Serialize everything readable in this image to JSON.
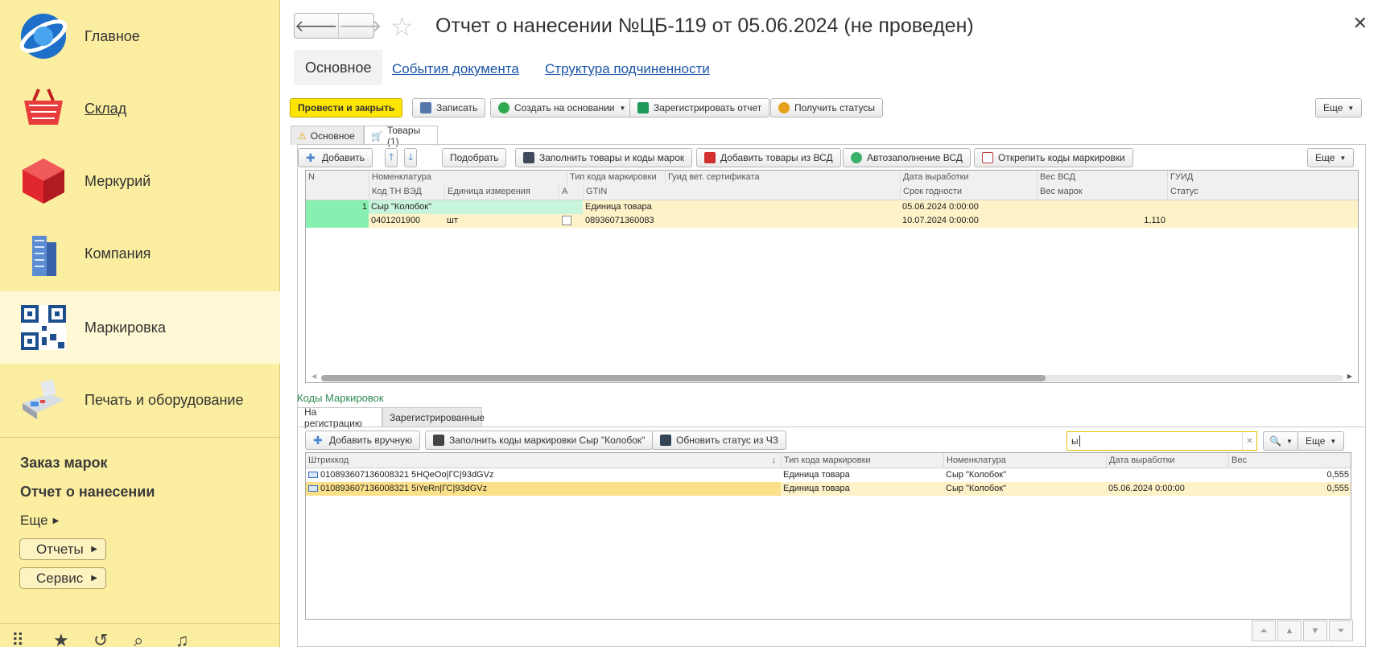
{
  "sidebar": {
    "items": [
      {
        "label": "Главное",
        "icon": "globe-icon"
      },
      {
        "label": "Склад",
        "icon": "basket-icon"
      },
      {
        "label": "Меркурий",
        "icon": "cube-icon"
      },
      {
        "label": "Компания",
        "icon": "building-icon"
      },
      {
        "label": "Маркировка",
        "icon": "qr-code-icon"
      },
      {
        "label": "Печать и оборудование",
        "icon": "card-terminal-icon"
      }
    ],
    "links": [
      "Заказ марок",
      "Отчет о нанесении"
    ],
    "more": "Еще",
    "reports_btn": "Отчеты",
    "service_btn": "Сервис"
  },
  "header": {
    "title": "Отчет о нанесении №ЦБ-119 от 05.06.2024 (не проведен)",
    "tabs": [
      "Основное",
      "События документа",
      "Структура подчиненности"
    ]
  },
  "toolbar": {
    "post_close": "Провести и закрыть",
    "save": "Записать",
    "create_based": "Создать на основании",
    "register_report": "Зарегистрировать отчет",
    "get_statuses": "Получить статусы",
    "more": "Еще"
  },
  "form_tabs": [
    "Основное",
    "Товары (1)"
  ],
  "goods_toolbar": {
    "add": "Добавить",
    "select": "Подобрать",
    "fill_goods": "Заполнить товары и коды марок",
    "add_from_vsd": "Добавить товары из ВСД",
    "autofill_vsd": "Автозаполнение ВСД",
    "detach_codes": "Открепить коды маркировки",
    "more": "Еще"
  },
  "goods_table": {
    "headers_row1": [
      "N",
      "Номенклатура",
      "Тип кода маркировки",
      "Гуид вет. сертификата",
      "Дата выработки",
      "Вес ВСД",
      "ГУИД"
    ],
    "headers_row2": [
      "Код ТН ВЭД",
      "Единица измерения",
      "А",
      "GTIN",
      "Срок годности",
      "Вес марок",
      "Статус"
    ],
    "row": {
      "n": "1",
      "nomenclature": "Сыр \"Колобок\"",
      "code_type": "Единица товара",
      "production_date": "05.06.2024 0:00:00",
      "tnved": "0401201900",
      "unit": "шт",
      "gtin": "08936071360083",
      "expiry": "10.07.2024 0:00:00",
      "marks_weight": "1,110"
    }
  },
  "codes_section": {
    "label": "Коды Маркировок",
    "tabs": [
      "На регистрацию",
      "Зарегистрированные"
    ],
    "add_manual": "Добавить вручную",
    "fill_codes": "Заполнить коды маркировки Сыр \"Колобок\"",
    "update_status": "Обновить статус из ЧЗ",
    "search_value": "ы",
    "more": "Еще",
    "headers": [
      "Штрихкод",
      "Тип кода маркировки",
      "Номенклатура",
      "Дата выработки",
      "Вес"
    ],
    "rows": [
      {
        "barcode": "010893607136008321 5HQeOo|ГС|93dGVz",
        "type": "Единица товара",
        "nomenclature": "Сыр \"Колобок\"",
        "date": "",
        "weight": "0,555"
      },
      {
        "barcode": "010893607136008321 5iYeRn|ГС|93dGVz",
        "type": "Единица товара",
        "nomenclature": "Сыр \"Колобок\"",
        "date": "05.06.2024 0:00:00",
        "weight": "0,555"
      }
    ]
  }
}
